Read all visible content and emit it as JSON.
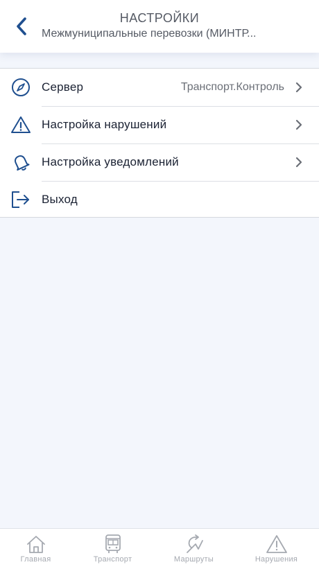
{
  "header": {
    "title": "НАСТРОЙКИ",
    "subtitle": "Межмуниципальные перевозки (МИНТР...",
    "back_icon": "chevron-left-icon"
  },
  "menu": {
    "items": [
      {
        "label": "Сервер",
        "value": "Транспорт.Контроль",
        "icon": "compass-icon",
        "has_chevron": true
      },
      {
        "label": "Настройка нарушений",
        "icon": "warning-icon",
        "has_chevron": true
      },
      {
        "label": "Настройка уведомлений",
        "icon": "bell-icon",
        "has_chevron": true
      },
      {
        "label": "Выход",
        "icon": "logout-icon",
        "has_chevron": false
      }
    ]
  },
  "tabbar": {
    "tabs": [
      {
        "label": "Главная",
        "icon": "home-icon"
      },
      {
        "label": "Транспорт",
        "icon": "bus-icon"
      },
      {
        "label": "Маршруты",
        "icon": "route-icon"
      },
      {
        "label": "Нарушения",
        "icon": "warning-icon"
      }
    ]
  },
  "colors": {
    "accent": "#1f4f8f",
    "background": "#f3f6fc",
    "tab_inactive": "#a5a9b0"
  }
}
